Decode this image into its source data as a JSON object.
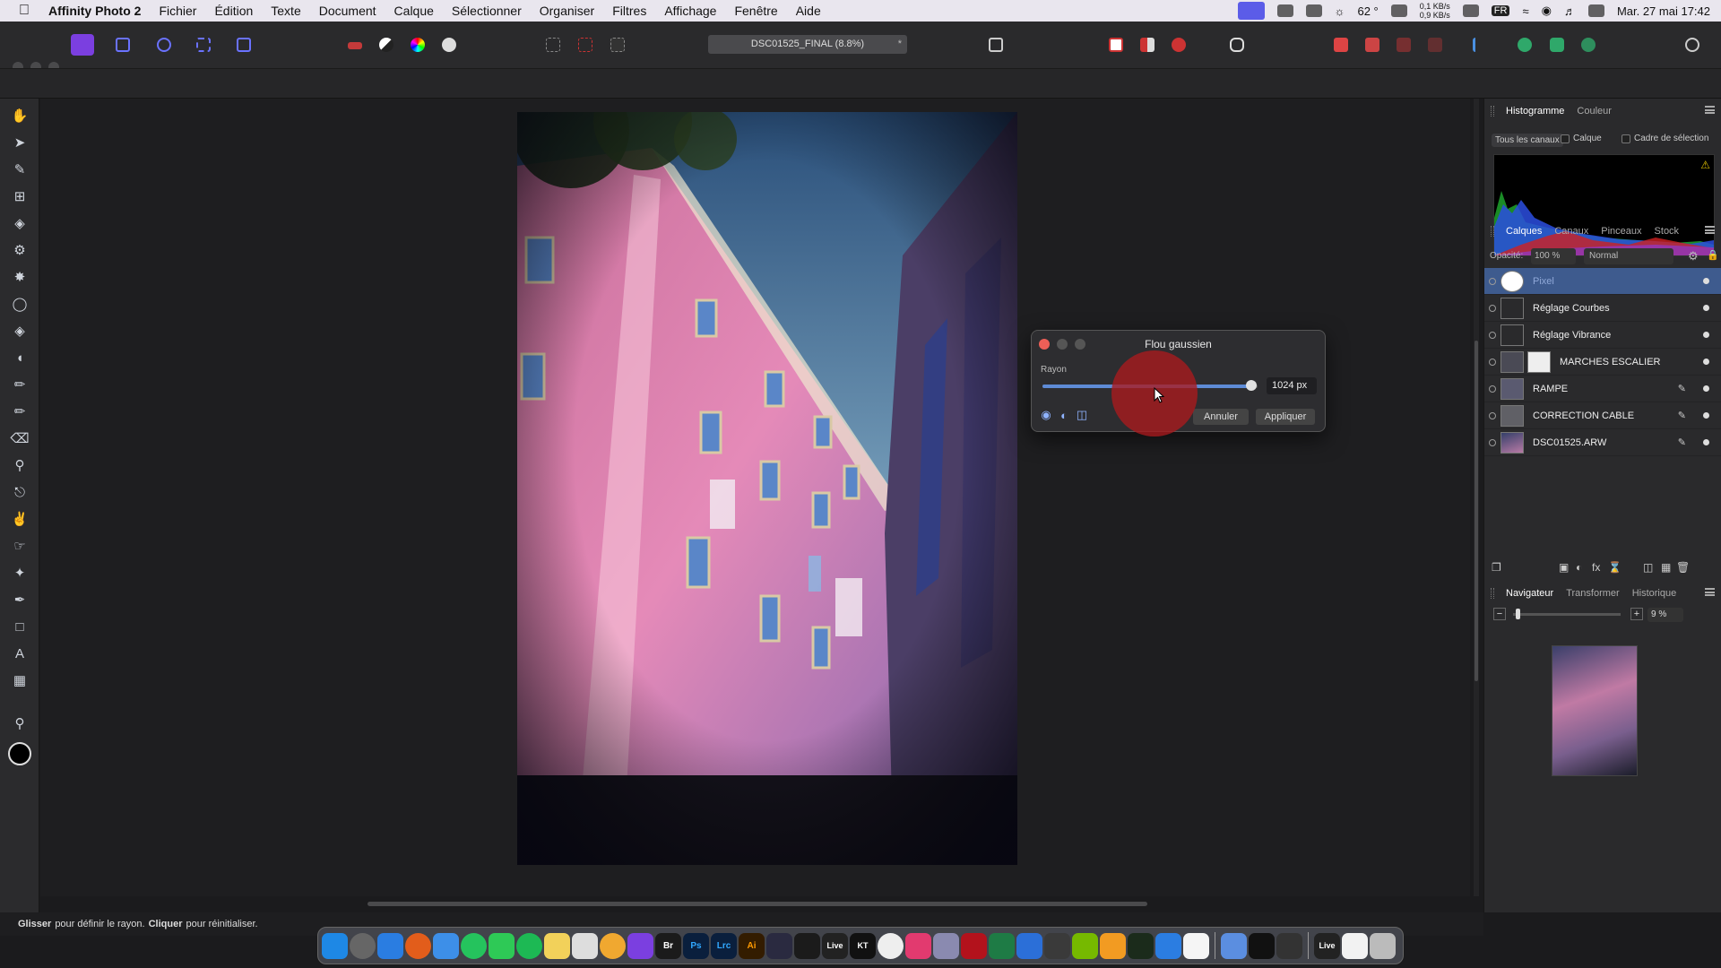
{
  "menubar": {
    "app_name": "Affinity Photo 2",
    "items": [
      "Fichier",
      "Édition",
      "Texte",
      "Document",
      "Calque",
      "Sélectionner",
      "Organiser",
      "Filtres",
      "Affichage",
      "Fenêtre",
      "Aide"
    ],
    "temperature": "62 °",
    "net_up": "0,1 KB/s",
    "net_down": "0,9 KB/s",
    "lang": "FR",
    "datetime": "Mar. 27 mai  17:42"
  },
  "document": {
    "tab_title": "DSC01525_FINAL (8.8%)",
    "modified_mark": "*"
  },
  "dialog": {
    "title": "Flou gaussien",
    "radius_label": "Rayon",
    "radius_value": "1024 px",
    "radius_fraction": 0.97,
    "cancel_label": "Annuler",
    "apply_label": "Appliquer"
  },
  "status": {
    "drag_bold": "Glisser",
    "drag_text": "pour définir le rayon.",
    "click_bold": "Cliquer",
    "click_text": "pour réinitialiser."
  },
  "histogram_panel": {
    "tabs": [
      "Histogramme",
      "Couleur"
    ],
    "channel_select": "Tous les canaux",
    "layer_checkbox": "Calque",
    "selection_checkbox": "Cadre de sélection"
  },
  "layers_panel": {
    "tabs": [
      "Calques",
      "Canaux",
      "Pinceaux",
      "Stock"
    ],
    "opacity_label": "Opacité:",
    "opacity_value": "100 %",
    "blend_mode": "Normal",
    "layers": [
      {
        "name": "Pixel",
        "selected": true
      },
      {
        "name": "Réglage Courbes"
      },
      {
        "name": "Réglage Vibrance"
      },
      {
        "name": "MARCHES ESCALIER"
      },
      {
        "name": "RAMPE"
      },
      {
        "name": "CORRECTION CABLE"
      },
      {
        "name": "DSC01525.ARW"
      }
    ]
  },
  "navigator_panel": {
    "tabs": [
      "Navigateur",
      "Transformer",
      "Historique"
    ],
    "zoom_value": "9 %"
  },
  "dock": {
    "app_labels": [
      "Br",
      "Ps",
      "Lrc",
      "Ai",
      "Live",
      "KT",
      "Live"
    ]
  },
  "colors": {
    "accent": "#3e5b8e",
    "slider": "#5e8bd6",
    "close": "#ed5f57"
  }
}
